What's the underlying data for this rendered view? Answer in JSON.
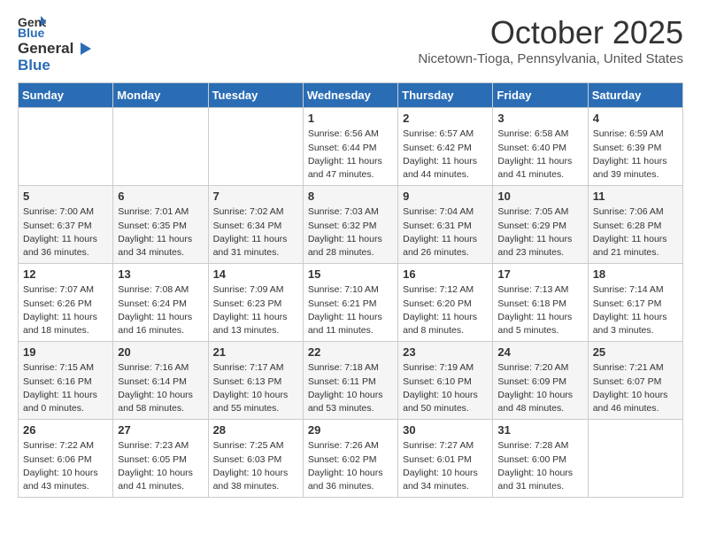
{
  "header": {
    "logo_general": "General",
    "logo_blue": "Blue",
    "month_title": "October 2025",
    "location": "Nicetown-Tioga, Pennsylvania, United States"
  },
  "days_of_week": [
    "Sunday",
    "Monday",
    "Tuesday",
    "Wednesday",
    "Thursday",
    "Friday",
    "Saturday"
  ],
  "weeks": [
    [
      {
        "day": "",
        "info": ""
      },
      {
        "day": "",
        "info": ""
      },
      {
        "day": "",
        "info": ""
      },
      {
        "day": "1",
        "info": "Sunrise: 6:56 AM\nSunset: 6:44 PM\nDaylight: 11 hours\nand 47 minutes."
      },
      {
        "day": "2",
        "info": "Sunrise: 6:57 AM\nSunset: 6:42 PM\nDaylight: 11 hours\nand 44 minutes."
      },
      {
        "day": "3",
        "info": "Sunrise: 6:58 AM\nSunset: 6:40 PM\nDaylight: 11 hours\nand 41 minutes."
      },
      {
        "day": "4",
        "info": "Sunrise: 6:59 AM\nSunset: 6:39 PM\nDaylight: 11 hours\nand 39 minutes."
      }
    ],
    [
      {
        "day": "5",
        "info": "Sunrise: 7:00 AM\nSunset: 6:37 PM\nDaylight: 11 hours\nand 36 minutes."
      },
      {
        "day": "6",
        "info": "Sunrise: 7:01 AM\nSunset: 6:35 PM\nDaylight: 11 hours\nand 34 minutes."
      },
      {
        "day": "7",
        "info": "Sunrise: 7:02 AM\nSunset: 6:34 PM\nDaylight: 11 hours\nand 31 minutes."
      },
      {
        "day": "8",
        "info": "Sunrise: 7:03 AM\nSunset: 6:32 PM\nDaylight: 11 hours\nand 28 minutes."
      },
      {
        "day": "9",
        "info": "Sunrise: 7:04 AM\nSunset: 6:31 PM\nDaylight: 11 hours\nand 26 minutes."
      },
      {
        "day": "10",
        "info": "Sunrise: 7:05 AM\nSunset: 6:29 PM\nDaylight: 11 hours\nand 23 minutes."
      },
      {
        "day": "11",
        "info": "Sunrise: 7:06 AM\nSunset: 6:28 PM\nDaylight: 11 hours\nand 21 minutes."
      }
    ],
    [
      {
        "day": "12",
        "info": "Sunrise: 7:07 AM\nSunset: 6:26 PM\nDaylight: 11 hours\nand 18 minutes."
      },
      {
        "day": "13",
        "info": "Sunrise: 7:08 AM\nSunset: 6:24 PM\nDaylight: 11 hours\nand 16 minutes."
      },
      {
        "day": "14",
        "info": "Sunrise: 7:09 AM\nSunset: 6:23 PM\nDaylight: 11 hours\nand 13 minutes."
      },
      {
        "day": "15",
        "info": "Sunrise: 7:10 AM\nSunset: 6:21 PM\nDaylight: 11 hours\nand 11 minutes."
      },
      {
        "day": "16",
        "info": "Sunrise: 7:12 AM\nSunset: 6:20 PM\nDaylight: 11 hours\nand 8 minutes."
      },
      {
        "day": "17",
        "info": "Sunrise: 7:13 AM\nSunset: 6:18 PM\nDaylight: 11 hours\nand 5 minutes."
      },
      {
        "day": "18",
        "info": "Sunrise: 7:14 AM\nSunset: 6:17 PM\nDaylight: 11 hours\nand 3 minutes."
      }
    ],
    [
      {
        "day": "19",
        "info": "Sunrise: 7:15 AM\nSunset: 6:16 PM\nDaylight: 11 hours\nand 0 minutes."
      },
      {
        "day": "20",
        "info": "Sunrise: 7:16 AM\nSunset: 6:14 PM\nDaylight: 10 hours\nand 58 minutes."
      },
      {
        "day": "21",
        "info": "Sunrise: 7:17 AM\nSunset: 6:13 PM\nDaylight: 10 hours\nand 55 minutes."
      },
      {
        "day": "22",
        "info": "Sunrise: 7:18 AM\nSunset: 6:11 PM\nDaylight: 10 hours\nand 53 minutes."
      },
      {
        "day": "23",
        "info": "Sunrise: 7:19 AM\nSunset: 6:10 PM\nDaylight: 10 hours\nand 50 minutes."
      },
      {
        "day": "24",
        "info": "Sunrise: 7:20 AM\nSunset: 6:09 PM\nDaylight: 10 hours\nand 48 minutes."
      },
      {
        "day": "25",
        "info": "Sunrise: 7:21 AM\nSunset: 6:07 PM\nDaylight: 10 hours\nand 46 minutes."
      }
    ],
    [
      {
        "day": "26",
        "info": "Sunrise: 7:22 AM\nSunset: 6:06 PM\nDaylight: 10 hours\nand 43 minutes."
      },
      {
        "day": "27",
        "info": "Sunrise: 7:23 AM\nSunset: 6:05 PM\nDaylight: 10 hours\nand 41 minutes."
      },
      {
        "day": "28",
        "info": "Sunrise: 7:25 AM\nSunset: 6:03 PM\nDaylight: 10 hours\nand 38 minutes."
      },
      {
        "day": "29",
        "info": "Sunrise: 7:26 AM\nSunset: 6:02 PM\nDaylight: 10 hours\nand 36 minutes."
      },
      {
        "day": "30",
        "info": "Sunrise: 7:27 AM\nSunset: 6:01 PM\nDaylight: 10 hours\nand 34 minutes."
      },
      {
        "day": "31",
        "info": "Sunrise: 7:28 AM\nSunset: 6:00 PM\nDaylight: 10 hours\nand 31 minutes."
      },
      {
        "day": "",
        "info": ""
      }
    ]
  ]
}
